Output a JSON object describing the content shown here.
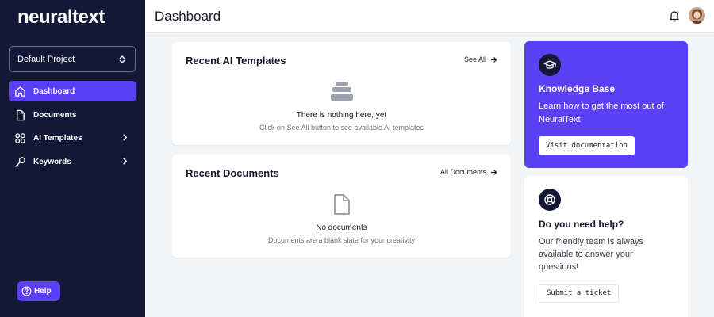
{
  "brand": {
    "logo_text": "neuraltext",
    "accent_color": "#5b3ff5",
    "sidebar_color": "#131836"
  },
  "sidebar": {
    "project_selector": {
      "value": "Default Project",
      "icon": "chevron-up-down-icon"
    },
    "items": [
      {
        "label": "Dashboard",
        "icon": "home-icon",
        "active": true,
        "has_submenu": false
      },
      {
        "label": "Documents",
        "icon": "document-icon",
        "active": false,
        "has_submenu": false
      },
      {
        "label": "AI Templates",
        "icon": "grid-icon",
        "active": false,
        "has_submenu": true
      },
      {
        "label": "Keywords",
        "icon": "key-icon",
        "active": false,
        "has_submenu": true
      }
    ],
    "help_button": {
      "label": "Help",
      "icon": "question-circle-icon"
    }
  },
  "header": {
    "title": "Dashboard",
    "icons": [
      "bell-icon",
      "avatar"
    ]
  },
  "main": {
    "templates_card": {
      "title": "Recent AI Templates",
      "link_label": "See All",
      "empty_icon": "stack-icon",
      "empty_title": "There is nothing here, yet",
      "empty_subtitle": "Click on See All button to see available AI templates"
    },
    "documents_card": {
      "title": "Recent Documents",
      "link_label": "All Documents",
      "empty_icon": "document-icon",
      "empty_title": "No documents",
      "empty_subtitle": "Documents are a blank slate for your creativity"
    }
  },
  "right": {
    "knowledge_base": {
      "icon": "graduation-cap-icon",
      "title": "Knowledge Base",
      "text": "Learn how to get the most out of NeuralText",
      "button_label": "Visit documentation"
    },
    "help_card": {
      "icon": "lifebuoy-icon",
      "title": "Do you need help?",
      "text": "Our friendly team is always available to answer your questions!",
      "button_label": "Submit a ticket"
    }
  }
}
